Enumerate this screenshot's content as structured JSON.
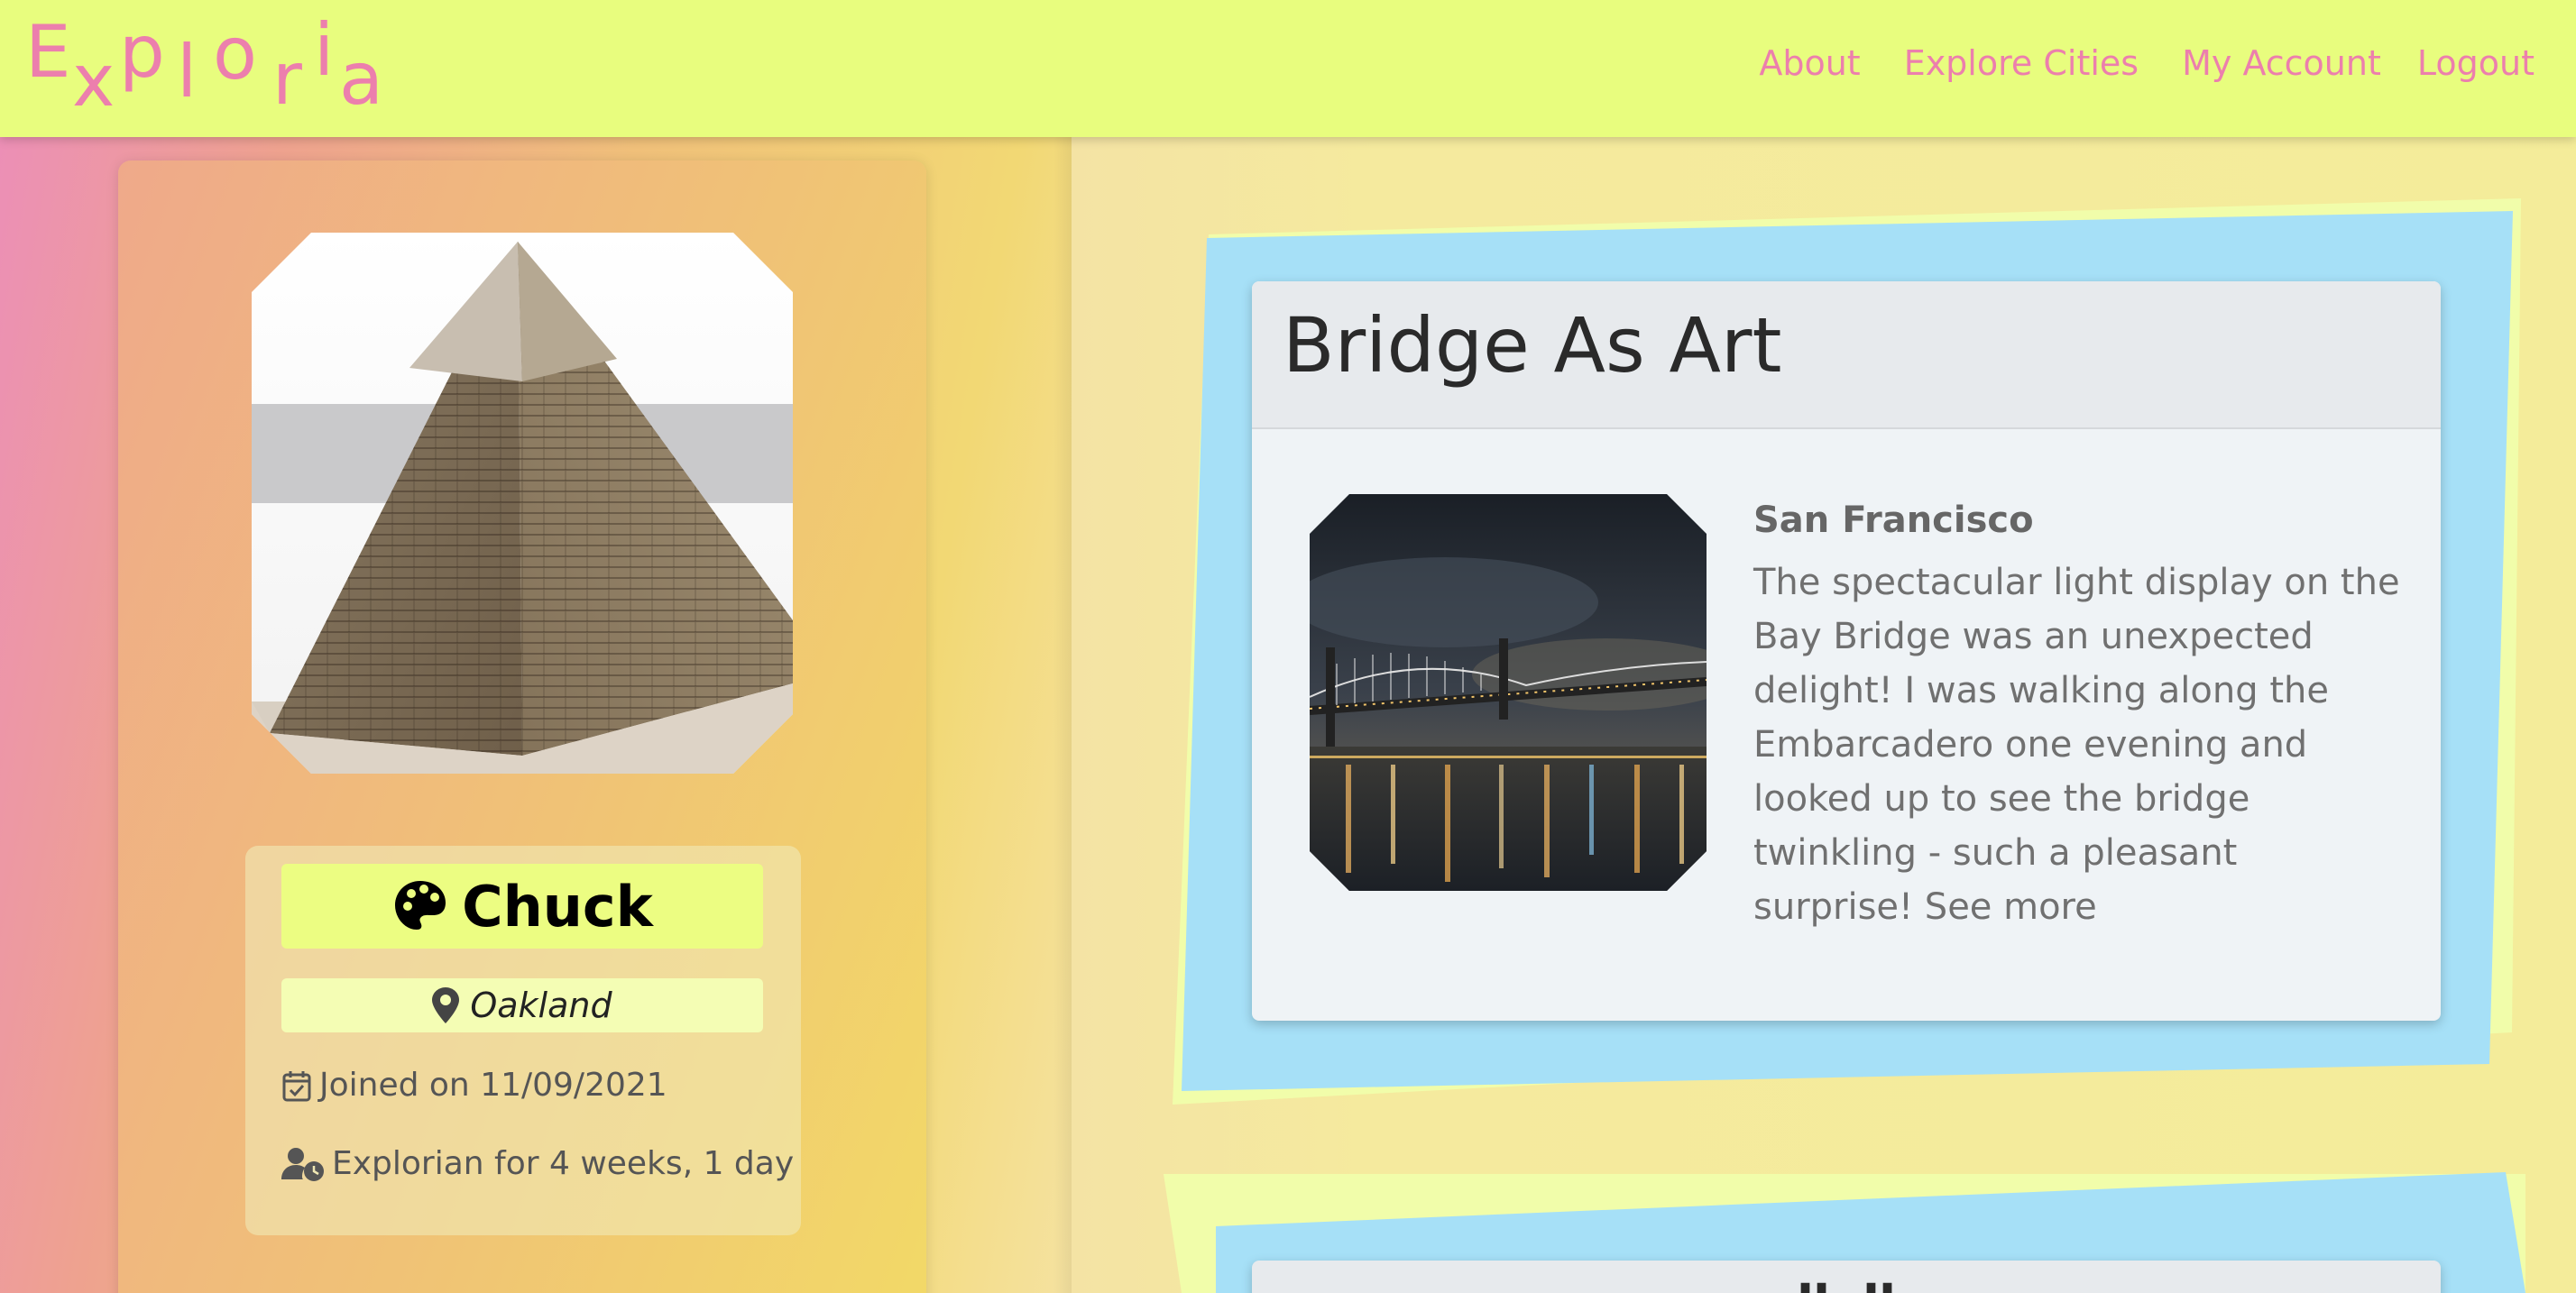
{
  "app": {
    "logo_letters": [
      "E",
      "x",
      "p",
      "l",
      "o",
      "r",
      "i",
      "a"
    ],
    "brand_color": "#ec7fad",
    "nav_bg": "#e8fd7e"
  },
  "nav": {
    "items": [
      {
        "label": "About"
      },
      {
        "label": "Explore Cities"
      },
      {
        "label": "My Account"
      },
      {
        "label": "Logout"
      }
    ]
  },
  "profile": {
    "avatar_icon": "pyramid-photo",
    "name_icon": "palette-icon",
    "name": "Chuck",
    "city_icon": "map-marker-icon",
    "city": "Oakland",
    "joined_icon": "calendar-check-icon",
    "joined": "Joined on 11/09/2021",
    "tenure_icon": "user-clock-icon",
    "tenure": "Explorian for 4 weeks, 1 day"
  },
  "posts": [
    {
      "title": "Bridge As Art",
      "image_icon": "bay-bridge-night-photo",
      "city": "San Francisco",
      "body": "The spectacular light display on the Bay Bridge was an unexpected delight! I was walking along the Embarcadero one evening and looked up to see the bridge twinkling - such a pleasant surprise!",
      "more_label": "See more"
    },
    {
      "title": "\"                    \""
    }
  ]
}
